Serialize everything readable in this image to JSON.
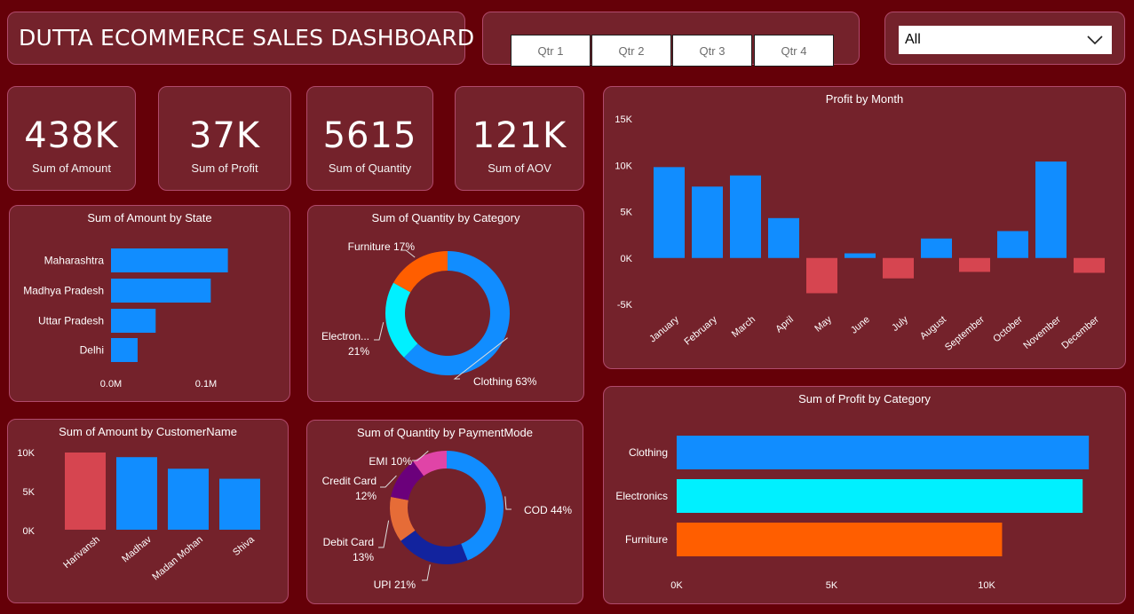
{
  "header": {
    "title": "DUTTA ECOMMERCE SALES DASHBOARD",
    "quarters": [
      "Qtr 1",
      "Qtr 2",
      "Qtr 3",
      "Qtr 4"
    ],
    "state_filter": {
      "value": "All"
    }
  },
  "kpis": [
    {
      "value": "438K",
      "label": "Sum of Amount"
    },
    {
      "value": "37K",
      "label": "Sum of Profit"
    },
    {
      "value": "5615",
      "label": "Sum of Quantity"
    },
    {
      "value": "121K",
      "label": "Sum of AOV"
    }
  ],
  "colors": {
    "blue": "#118dff",
    "red": "#d64550",
    "cyan": "#00f0ff",
    "orange": "#ff5e00",
    "navy": "#12239e",
    "coral": "#e66c37",
    "purple": "#6b007b",
    "pink": "#e044a7",
    "bg": "#650008",
    "card": "#74222b"
  },
  "chart_data": [
    {
      "id": "state",
      "type": "bar",
      "orientation": "horizontal",
      "title": "Sum of Amount by State",
      "categories": [
        "Maharashtra",
        "Madhya Pradesh",
        "Uttar Pradesh",
        "Delhi"
      ],
      "values": [
        0.123,
        0.105,
        0.047,
        0.028
      ],
      "xticks": [
        "0.0M",
        "0.1M"
      ],
      "xlim": [
        0,
        0.1
      ]
    },
    {
      "id": "qty_category",
      "type": "pie",
      "donut": true,
      "title": "Sum of Quantity by Category",
      "slices": [
        {
          "name": "Clothing",
          "value": 63,
          "label": "Clothing 63%",
          "color": "#118dff"
        },
        {
          "name": "Electronics",
          "value": 21,
          "label": "Electron...",
          "label2": "21%",
          "color": "#00f0ff"
        },
        {
          "name": "Furniture",
          "value": 17,
          "label": "Furniture 17%",
          "color": "#ff5e00"
        }
      ]
    },
    {
      "id": "customer",
      "type": "bar",
      "title": "Sum of Amount by CustomerName",
      "categories": [
        "Harivansh",
        "Madhav",
        "Madan Mohan",
        "Shiva"
      ],
      "values": [
        10000,
        9400,
        7900,
        6600
      ],
      "highlight": [
        true,
        false,
        false,
        false
      ],
      "yticks": [
        "10K",
        "5K",
        "0K"
      ],
      "ylim": [
        0,
        10000
      ]
    },
    {
      "id": "qty_payment",
      "type": "pie",
      "donut": true,
      "title": "Sum of Quantity by PaymentMode",
      "slices": [
        {
          "name": "COD",
          "value": 44,
          "label": "COD 44%",
          "color": "#118dff"
        },
        {
          "name": "UPI",
          "value": 21,
          "label": "UPI 21%",
          "color": "#12239e"
        },
        {
          "name": "Debit Card",
          "value": 13,
          "label": "Debit Card",
          "label2": "13%",
          "color": "#e66c37"
        },
        {
          "name": "Credit Card",
          "value": 12,
          "label": "Credit Card",
          "label2": "12%",
          "color": "#6b007b"
        },
        {
          "name": "EMI",
          "value": 10,
          "label": "EMI 10%",
          "color": "#e044a7"
        }
      ]
    },
    {
      "id": "profit_month",
      "type": "bar",
      "title": "Profit by Month",
      "categories": [
        "January",
        "February",
        "March",
        "April",
        "May",
        "June",
        "July",
        "August",
        "September",
        "October",
        "November",
        "December"
      ],
      "values": [
        9800,
        7700,
        8900,
        4300,
        -3800,
        500,
        -2200,
        2100,
        -1500,
        2900,
        10400,
        -1600
      ],
      "yticks": [
        "15K",
        "10K",
        "5K",
        "0K",
        "-5K"
      ],
      "ylim": [
        -5000,
        15000
      ]
    },
    {
      "id": "profit_category",
      "type": "bar",
      "orientation": "horizontal",
      "title": "Sum of Profit by Category",
      "categories": [
        "Clothing",
        "Electronics",
        "Furniture"
      ],
      "values": [
        13300,
        13100,
        10500
      ],
      "bar_colors": [
        "#118dff",
        "#00f0ff",
        "#ff5e00"
      ],
      "xticks": [
        "0K",
        "5K",
        "10K"
      ],
      "xlim": [
        0,
        10000
      ]
    }
  ]
}
